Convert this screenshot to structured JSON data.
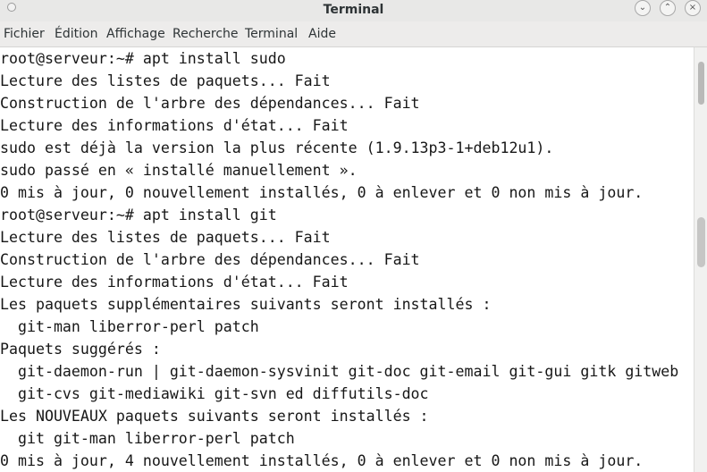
{
  "window": {
    "title": "Terminal",
    "minimize_glyph": "⌄",
    "maximize_glyph": "⌃",
    "close_glyph": "×"
  },
  "menu": [
    "Fichier",
    "Édition",
    "Affichage",
    "Recherche",
    "Terminal",
    "Aide"
  ],
  "terminal": {
    "lines": [
      "root@serveur:~# apt install sudo",
      "Lecture des listes de paquets... Fait",
      "Construction de l'arbre des dépendances... Fait",
      "Lecture des informations d'état... Fait",
      "sudo est déjà la version la plus récente (1.9.13p3-1+deb12u1).",
      "sudo passé en « installé manuellement ».",
      "0 mis à jour, 0 nouvellement installés, 0 à enlever et 0 non mis à jour.",
      "root@serveur:~# apt install git",
      "Lecture des listes de paquets... Fait",
      "Construction de l'arbre des dépendances... Fait",
      "Lecture des informations d'état... Fait",
      "Les paquets supplémentaires suivants seront installés :",
      "  git-man liberror-perl patch",
      "Paquets suggérés :",
      "  git-daemon-run | git-daemon-sysvinit git-doc git-email git-gui gitk gitweb",
      "  git-cvs git-mediawiki git-svn ed diffutils-doc",
      "Les NOUVEAUX paquets suivants seront installés :",
      "  git git-man liberror-perl patch",
      "0 mis à jour, 4 nouvellement installés, 0 à enlever et 0 non mis à jour."
    ]
  }
}
